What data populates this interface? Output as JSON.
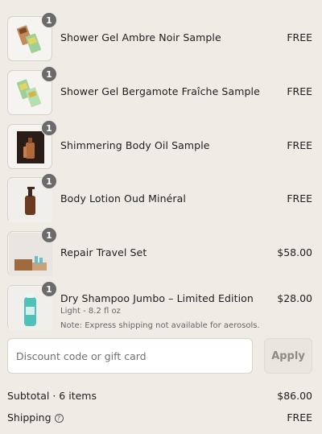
{
  "items": [
    {
      "name": "Shower Gel Ambre Noir Sample",
      "price": "FREE",
      "qty": "1",
      "image_icon": "sample-sachets-image"
    },
    {
      "name": "Shower Gel Bergamote Fraîche Sample",
      "price": "FREE",
      "qty": "1",
      "image_icon": "sample-sachets-image"
    },
    {
      "name": "Shimmering Body Oil Sample",
      "price": "FREE",
      "qty": "1",
      "image_icon": "body-oil-bottle-image"
    },
    {
      "name": "Body Lotion Oud Minéral",
      "price": "FREE",
      "qty": "1",
      "image_icon": "lotion-bottle-image"
    },
    {
      "name": "Repair Travel Set",
      "price": "$58.00",
      "qty": "1",
      "image_icon": "travel-set-image"
    },
    {
      "name": "Dry Shampoo Jumbo – Limited Edition",
      "price": "$28.00",
      "qty": "1",
      "variant": "Light - 8.2 fl oz",
      "note": "Note: Express shipping not available for aerosols.",
      "image_icon": "spray-can-image"
    }
  ],
  "discount": {
    "placeholder": "Discount code or gift card",
    "apply_label": "Apply"
  },
  "summary": {
    "subtotal_label": "Subtotal · 6 items",
    "subtotal_value": "$86.00",
    "shipping_label": "Shipping",
    "shipping_value": "FREE"
  },
  "colors": {
    "background": "#efebe5",
    "badge": "#6b6b6b",
    "text": "#1e1e1e"
  }
}
